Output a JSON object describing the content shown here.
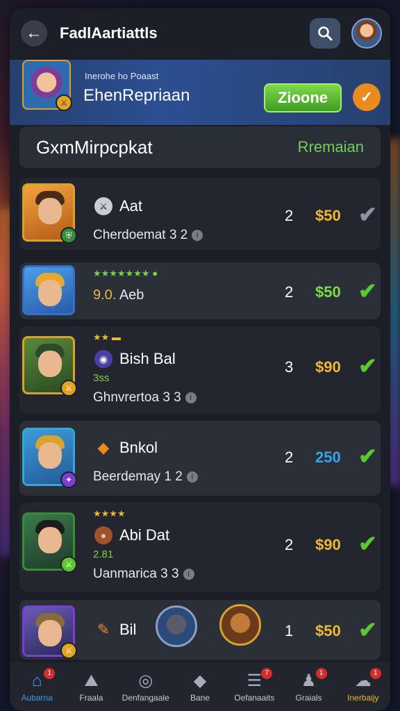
{
  "header": {
    "title": "FadlAartiattls",
    "back_icon": "←",
    "search_icon": "search-icon"
  },
  "banner": {
    "subtitle": "Inerohe ho Poaast",
    "title": "EhenRepriaan",
    "button_label": "Zioone",
    "check_icon": "✓"
  },
  "section": {
    "title": "GxmMirpcpkat",
    "right_label": "Rremaian"
  },
  "rows": [
    {
      "name": "Aat",
      "icon": "⚔",
      "stars": "",
      "small": "",
      "sub": "Cherdoemat 3 2",
      "level": "2",
      "price": "$50",
      "price_color": "#f2b733",
      "check_color": "#8f94a4",
      "frame": "#d8a22e",
      "badge": "#3b8c3a"
    },
    {
      "name": "Aeb",
      "prefix": "9.0.",
      "icon": "",
      "stars": "★★★★★★★ ●",
      "small": "",
      "sub": "",
      "level": "2",
      "price": "$50",
      "price_color": "#7fd84a",
      "check_color": "#5cc830",
      "frame": "#d8a22e",
      "badge": ""
    },
    {
      "name": "Bish Bal",
      "icon": "◉",
      "stars": "★★ ▬",
      "small": "3ss",
      "sub": "Ghnvrertoa 3 3",
      "level": "3",
      "price": "$90",
      "price_color": "#f2b733",
      "check_color": "#5cc830",
      "frame": "#d8a22e",
      "badge": "#e2a224"
    },
    {
      "name": "Bnkol",
      "icon": "◆",
      "stars": "",
      "small": "",
      "sub": "Beerdemay 1 2",
      "level": "2",
      "price": "250",
      "price_color": "#35a7e8",
      "check_color": "#5cc830",
      "frame": "#35a7d8",
      "badge": "#7a3fd0"
    },
    {
      "name": "Abi Dat",
      "icon": "●",
      "stars": "★★★★",
      "small": "2.81",
      "sub": "Uanmarica 3 3",
      "level": "2",
      "price": "$90",
      "price_color": "#f2b733",
      "check_color": "#5cc830",
      "frame": "#3b8c3a",
      "badge": "#5cc830"
    },
    {
      "name": "Bil",
      "icon": "✎",
      "stars": "",
      "small": "",
      "sub": "",
      "level": "1",
      "price": "$50",
      "price_color": "#f2b733",
      "check_color": "#5cc830",
      "frame": "#d8a22e",
      "badge": "#e2a224"
    }
  ],
  "tabs": [
    {
      "label": "Aubarna",
      "icon": "⌂",
      "badge": "1"
    },
    {
      "label": "Fraala",
      "icon": "⛰",
      "badge": ""
    },
    {
      "label": "Denfangaale",
      "icon": "◎",
      "badge": ""
    },
    {
      "label": "Bane",
      "icon": "◆",
      "badge": ""
    },
    {
      "label": "Oefanaaits",
      "icon": "☰",
      "badge": "7"
    },
    {
      "label": "Graials",
      "icon": "♟",
      "badge": "1"
    },
    {
      "label": "Inerbaijy",
      "icon": "☁",
      "badge": "1"
    }
  ]
}
